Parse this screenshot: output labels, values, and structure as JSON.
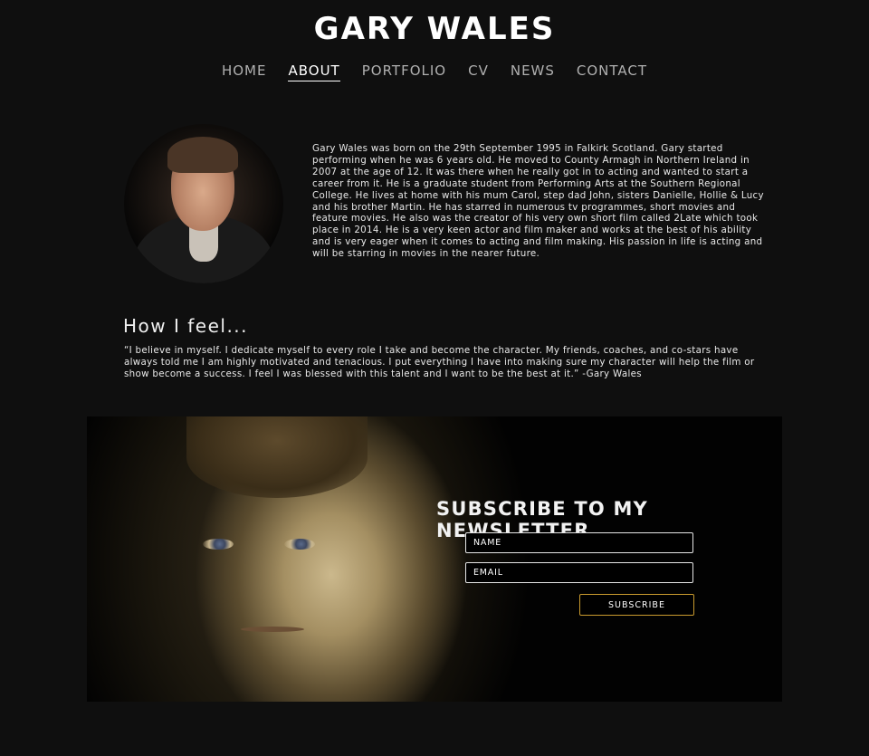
{
  "site": {
    "title": "GARY WALES"
  },
  "nav": {
    "items": [
      {
        "label": "HOME"
      },
      {
        "label": "ABOUT"
      },
      {
        "label": "PORTFOLIO"
      },
      {
        "label": "CV"
      },
      {
        "label": "NEWS"
      },
      {
        "label": "CONTACT"
      }
    ],
    "active": "ABOUT"
  },
  "about": {
    "bio": "Gary Wales was born on the 29th September 1995 in Falkirk Scotland. Gary started performing when he was 6 years old. He moved to County Armagh in Northern Ireland in 2007 at the age of 12. It was there when he really got in to acting and wanted to start a career from it. He is a graduate student from Performing Arts at the Southern Regional College. He lives at home with his mum Carol, step dad John, sisters Danielle, Hollie & Lucy and his brother Martin. He has starred in numerous tv programmes, short movies and feature movies. He also was the creator of his very own short film called 2Late which took place in 2014. He is a very keen actor and film maker and works at the best of his ability and is very eager when it comes to acting and film making. His passion in life is acting and will be starring in movies in the nearer future."
  },
  "feel": {
    "heading": "How I feel...",
    "quote": "“I believe in myself. I dedicate myself to every role I take and become the character. My friends, coaches, and co-stars have always told me I am highly motivated and tenacious. I put everything I have into making sure my character will help the film or show become a success. I feel I was blessed with this talent and I want to be the best at it.” -Gary Wales"
  },
  "newsletter": {
    "heading": "SUBSCRIBE TO MY NEWSLETTER",
    "name_placeholder": "NAME",
    "email_placeholder": "EMAIL",
    "button_label": "SUBSCRIBE"
  },
  "colors": {
    "background": "#0f0f0f",
    "text": "#ffffff",
    "nav_inactive": "#b0b0b0",
    "button_border": "#c99a2e"
  }
}
